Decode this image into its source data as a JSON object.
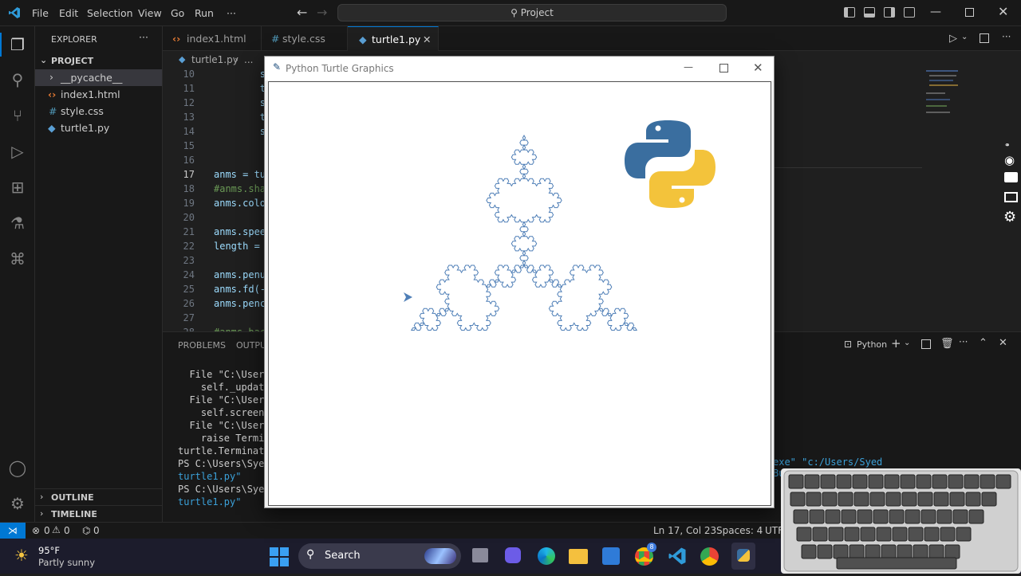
{
  "menu": [
    "File",
    "Edit",
    "Selection",
    "View",
    "Go",
    "Run",
    "···"
  ],
  "command_center": "Project",
  "sidebar": {
    "title": "EXPLORER",
    "project_label": "PROJECT",
    "items": [
      "__pycache__",
      "index1.html",
      "style.css",
      "turtle1.py"
    ],
    "outline": "OUTLINE",
    "timeline": "TIMELINE"
  },
  "tabs": [
    "index1.html",
    "style.css",
    "turtle1.py"
  ],
  "breadcrumb": [
    "turtle1.py",
    "..."
  ],
  "editor": {
    "lines": [
      {
        "n": "10",
        "code": "        snowf"
      },
      {
        "n": "11",
        "code": "        t.rig"
      },
      {
        "n": "12",
        "code": "        snowf"
      },
      {
        "n": "13",
        "code": "        t.lef"
      },
      {
        "n": "14",
        "code": "        snowf"
      },
      {
        "n": "15",
        "code": ""
      },
      {
        "n": "16",
        "code": ""
      },
      {
        "n": "17",
        "code": "anms = tu"
      },
      {
        "n": "18",
        "code": "#anms.sha"
      },
      {
        "n": "19",
        "code": "anms.colo"
      },
      {
        "n": "20",
        "code": ""
      },
      {
        "n": "21",
        "code": "anms.spee"
      },
      {
        "n": "22",
        "code": "length = "
      },
      {
        "n": "23",
        "code": ""
      },
      {
        "n": "24",
        "code": "anms.penu"
      },
      {
        "n": "25",
        "code": "anms.fd(-"
      },
      {
        "n": "26",
        "code": "anms.penc"
      },
      {
        "n": "27",
        "code": ""
      },
      {
        "n": "28",
        "code": "#anms.bac"
      }
    ]
  },
  "panel": {
    "tabs": [
      "PROBLEMS",
      "OUTPUT"
    ],
    "shell": "Python",
    "terminal": [
      "  File \"C:\\Users\\",
      "    self._update_",
      "  File \"C:\\Users\\",
      "    self.screen._",
      "  File \"C:\\Users\\",
      "    raise Termina",
      "turtle.Terminator",
      "PS C:\\Users\\Syed",
      "turtle1.py\"",
      "PS C:\\Users\\Syed",
      "turtle1.py\""
    ],
    "terminal_right": "exe\" \"c:/Users/Syed Buraque/Desktop/Project/"
  },
  "turtle_window": {
    "title": "Python Turtle Graphics"
  },
  "status": {
    "errors": "0",
    "warnings": "0",
    "ports": "0",
    "position": "Ln 17, Col 23",
    "spaces": "Spaces: 4",
    "encoding": "UTF"
  },
  "taskbar": {
    "temp": "95°F",
    "weather": "Partly sunny",
    "search": "Search",
    "chrome_badge": "8"
  },
  "colors": {
    "accent": "#0078d4",
    "curve": "#4f7fb7",
    "python_blue": "#3a6e9f",
    "python_yellow": "#f3c33b"
  }
}
